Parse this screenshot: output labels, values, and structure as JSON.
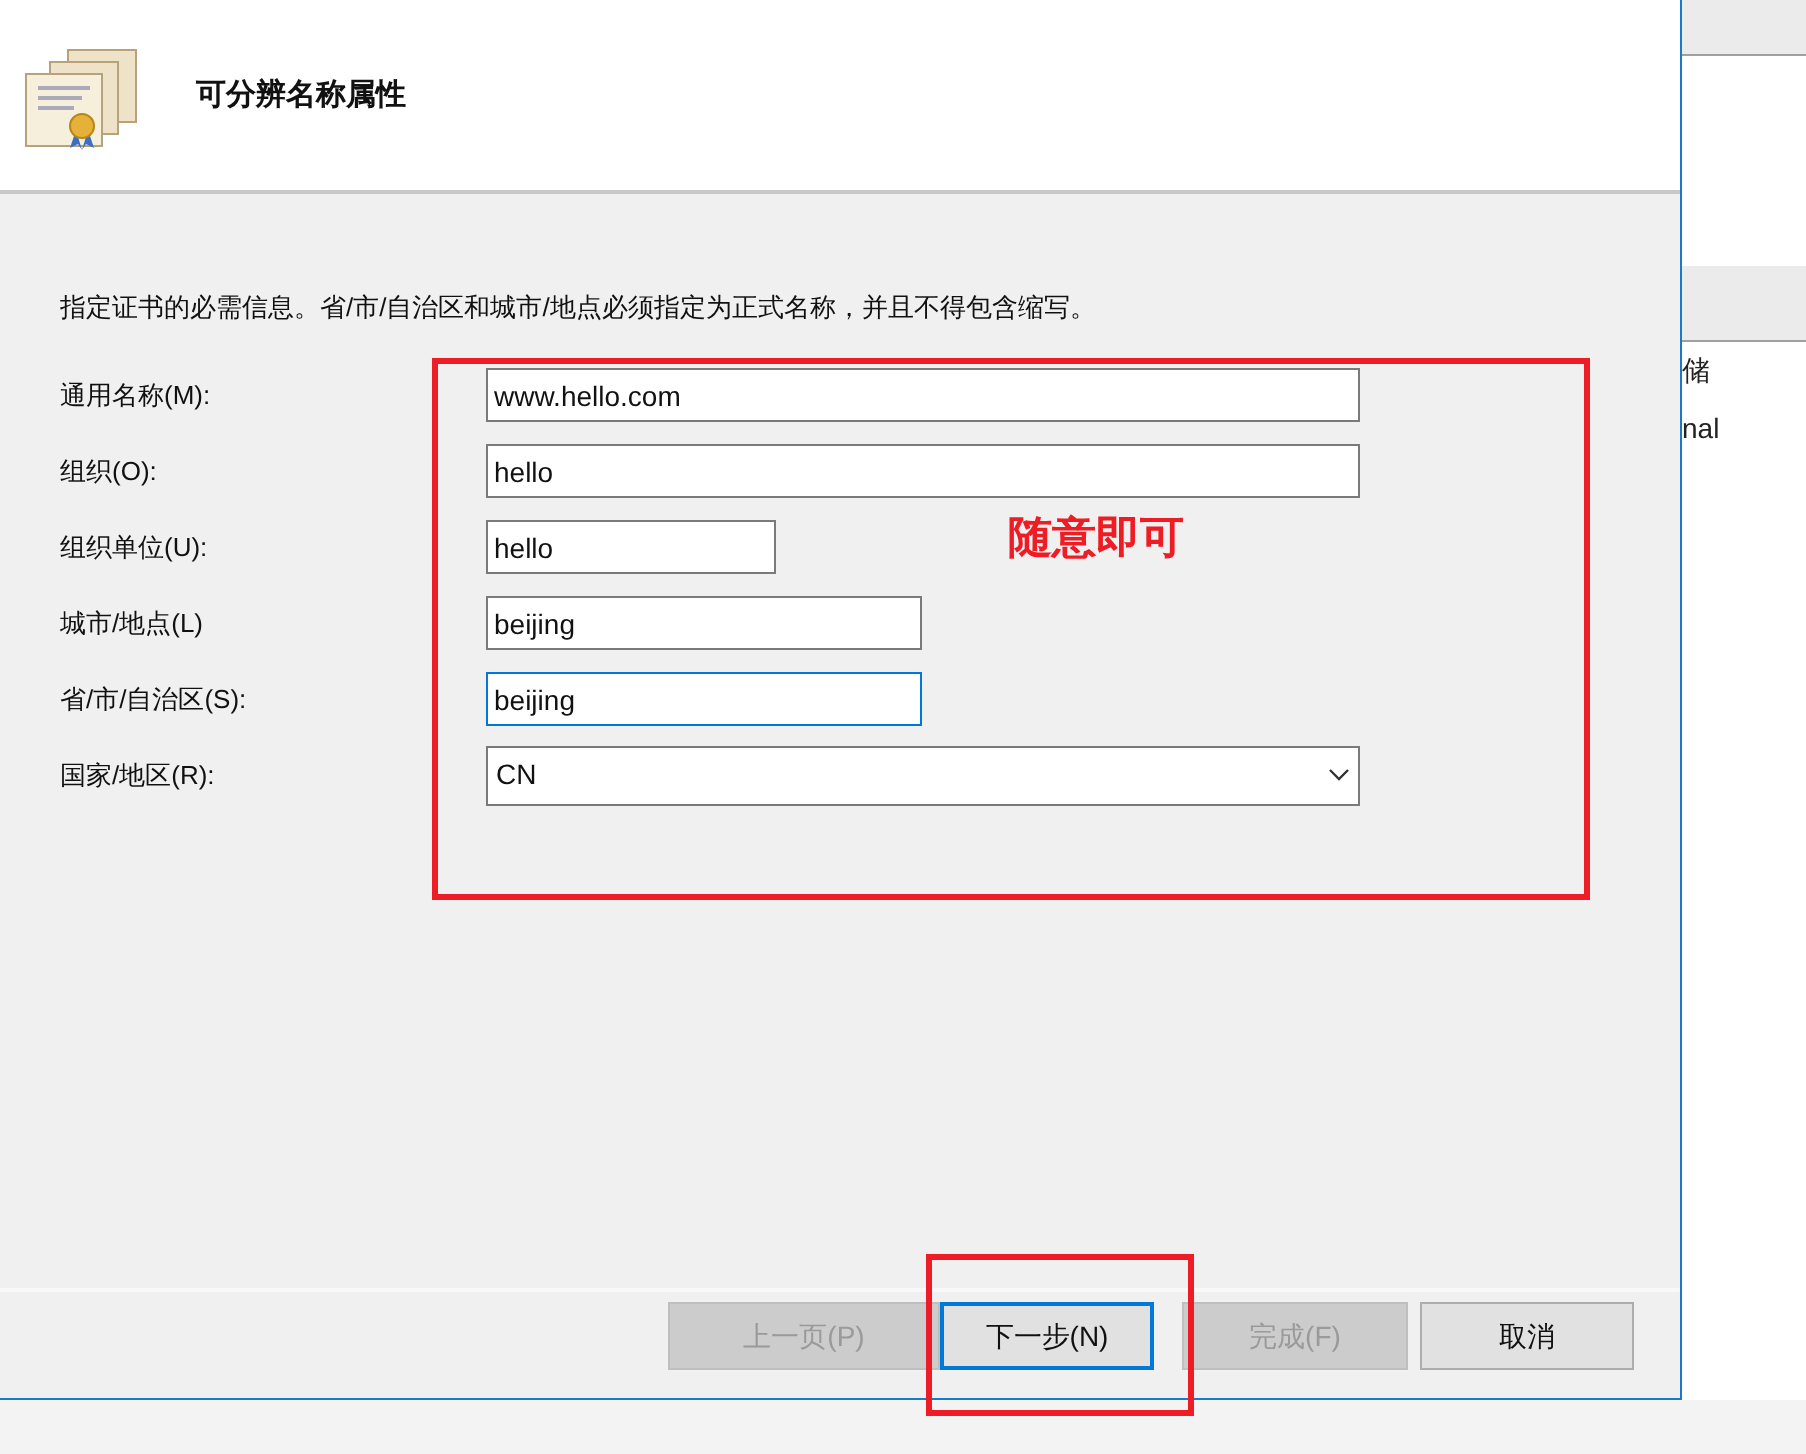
{
  "dialog": {
    "heading": "可分辨名称属性",
    "instruction": "指定证书的必需信息。省/市/自治区和城市/地点必须指定为正式名称，并且不得包含缩写。",
    "fields": [
      {
        "label": "通用名称(M):",
        "value": "www.hello.com",
        "kind": "text",
        "focused": false
      },
      {
        "label": "组织(O):",
        "value": "hello",
        "kind": "text",
        "focused": false
      },
      {
        "label": "组织单位(U):",
        "value": "hello",
        "kind": "text",
        "focused": false
      },
      {
        "label": "城市/地点(L)",
        "value": "beijing",
        "kind": "text",
        "focused": false
      },
      {
        "label": "省/市/自治区(S):",
        "value": "beijing",
        "kind": "text",
        "focused": true
      },
      {
        "label": "国家/地区(R):",
        "value": "CN",
        "kind": "dropdown",
        "focused": false
      }
    ],
    "buttons": [
      {
        "label": "上一页(P)",
        "disabled": true,
        "default": false
      },
      {
        "label": "下一步(N)",
        "disabled": false,
        "default": true
      },
      {
        "label": "完成(F)",
        "disabled": true,
        "default": false
      },
      {
        "label": "取消",
        "disabled": false,
        "default": false
      }
    ]
  },
  "annotation": {
    "note": "随意即可"
  },
  "background_panel": {
    "texts": [
      "储",
      "nal"
    ]
  }
}
